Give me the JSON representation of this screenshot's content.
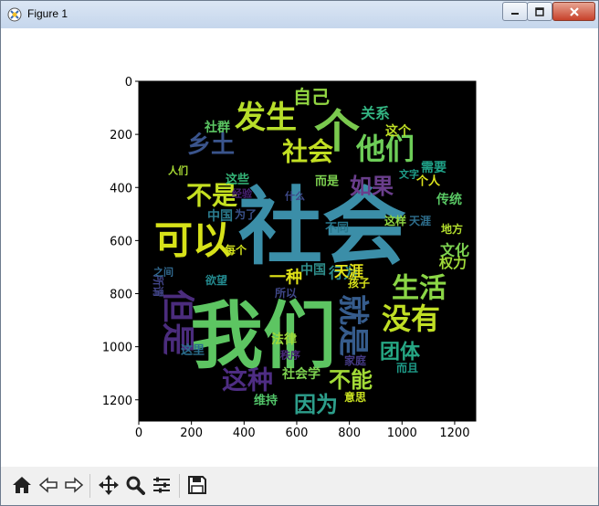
{
  "window": {
    "title": "Figure 1",
    "icons": {
      "app": "python-icon",
      "minimize": "minimize-icon",
      "maximize": "maximize-icon",
      "close": "close-icon"
    }
  },
  "plot": {
    "image": "wordcloud",
    "xticks": [
      "0",
      "200",
      "400",
      "600",
      "800",
      "1000",
      "1200"
    ],
    "yticks": [
      "0",
      "200",
      "400",
      "600",
      "800",
      "1000",
      "1200"
    ]
  },
  "wordcloud": [
    {
      "text": "社会",
      "color": "#3b8ea8"
    },
    {
      "text": "我们",
      "color": "#5dc562"
    },
    {
      "text": "个",
      "color": "#7ac94e"
    },
    {
      "text": "可以",
      "color": "#d7e219"
    },
    {
      "text": "发生",
      "color": "#b7de2a"
    },
    {
      "text": "乡土",
      "color": "#3a548c"
    },
    {
      "text": "社会",
      "color": "#c2df23"
    },
    {
      "text": "他们",
      "color": "#6ece58"
    },
    {
      "text": "自己",
      "color": "#92d642"
    },
    {
      "text": "不是",
      "color": "#c5e021"
    },
    {
      "text": "如果",
      "color": "#6a3e8c"
    },
    {
      "text": "但是",
      "color": "#4b2c7d"
    },
    {
      "text": "生活",
      "color": "#8bd646"
    },
    {
      "text": "就是",
      "color": "#365c8d"
    },
    {
      "text": "没有",
      "color": "#c0df25"
    },
    {
      "text": "这种",
      "color": "#4e2d83"
    },
    {
      "text": "团体",
      "color": "#26a784"
    },
    {
      "text": "不能",
      "color": "#a2da37"
    },
    {
      "text": "因为",
      "color": "#2d9f8c"
    },
    {
      "text": "文化",
      "color": "#7dd250"
    },
    {
      "text": "关系",
      "color": "#33b381"
    },
    {
      "text": "社群",
      "color": "#5cc763"
    },
    {
      "text": "中国",
      "color": "#2b7b8e"
    },
    {
      "text": "行为",
      "color": "#2c8a8d"
    },
    {
      "text": "一种",
      "color": "#e0e318"
    },
    {
      "text": "权力",
      "color": "#a0da39"
    },
    {
      "text": "传统",
      "color": "#59c864"
    },
    {
      "text": "需要",
      "color": "#1fa187"
    },
    {
      "text": "这个",
      "color": "#bfdf25"
    },
    {
      "text": "个人",
      "color": "#dbe31c"
    },
    {
      "text": "中国",
      "color": "#2f8e8b"
    },
    {
      "text": "天涯",
      "color": "#e4e419"
    },
    {
      "text": "这里",
      "color": "#2a6e8e"
    },
    {
      "text": "社会学",
      "color": "#7dd250"
    },
    {
      "text": "法律",
      "color": "#9fda3a"
    },
    {
      "text": "维持",
      "color": "#52c569"
    },
    {
      "text": "意思",
      "color": "#c8e020"
    },
    {
      "text": "而是",
      "color": "#7dd250"
    },
    {
      "text": "这些",
      "color": "#35b779"
    },
    {
      "text": "人们",
      "color": "#a8db34"
    },
    {
      "text": "孩子",
      "color": "#d8e219"
    },
    {
      "text": "不同",
      "color": "#29788e"
    },
    {
      "text": "地方",
      "color": "#b2dd2d"
    },
    {
      "text": "所以",
      "color": "#3f4788"
    },
    {
      "text": "什么",
      "color": "#3e4989"
    },
    {
      "text": "经验",
      "color": "#482173"
    },
    {
      "text": "为了",
      "color": "#3b528b"
    },
    {
      "text": "每个",
      "color": "#d2e21b"
    },
    {
      "text": "家庭",
      "color": "#443a83"
    },
    {
      "text": "而且",
      "color": "#1e9c89"
    },
    {
      "text": "秩序",
      "color": "#482878"
    },
    {
      "text": "所谓",
      "color": "#414487"
    },
    {
      "text": "欲望",
      "color": "#23898e"
    },
    {
      "text": "之间",
      "color": "#31688e"
    },
    {
      "text": "文字",
      "color": "#1f9e89"
    },
    {
      "text": "这样",
      "color": "#90d743"
    },
    {
      "text": "天涯",
      "color": "#2e6f8e"
    }
  ],
  "toolbar": {
    "buttons": [
      {
        "icon": "home-icon"
      },
      {
        "icon": "back-arrow-icon"
      },
      {
        "icon": "forward-arrow-icon"
      },
      {
        "icon": "pan-icon"
      },
      {
        "icon": "zoom-icon"
      },
      {
        "icon": "configure-subplots-icon"
      },
      {
        "icon": "save-icon"
      }
    ]
  }
}
